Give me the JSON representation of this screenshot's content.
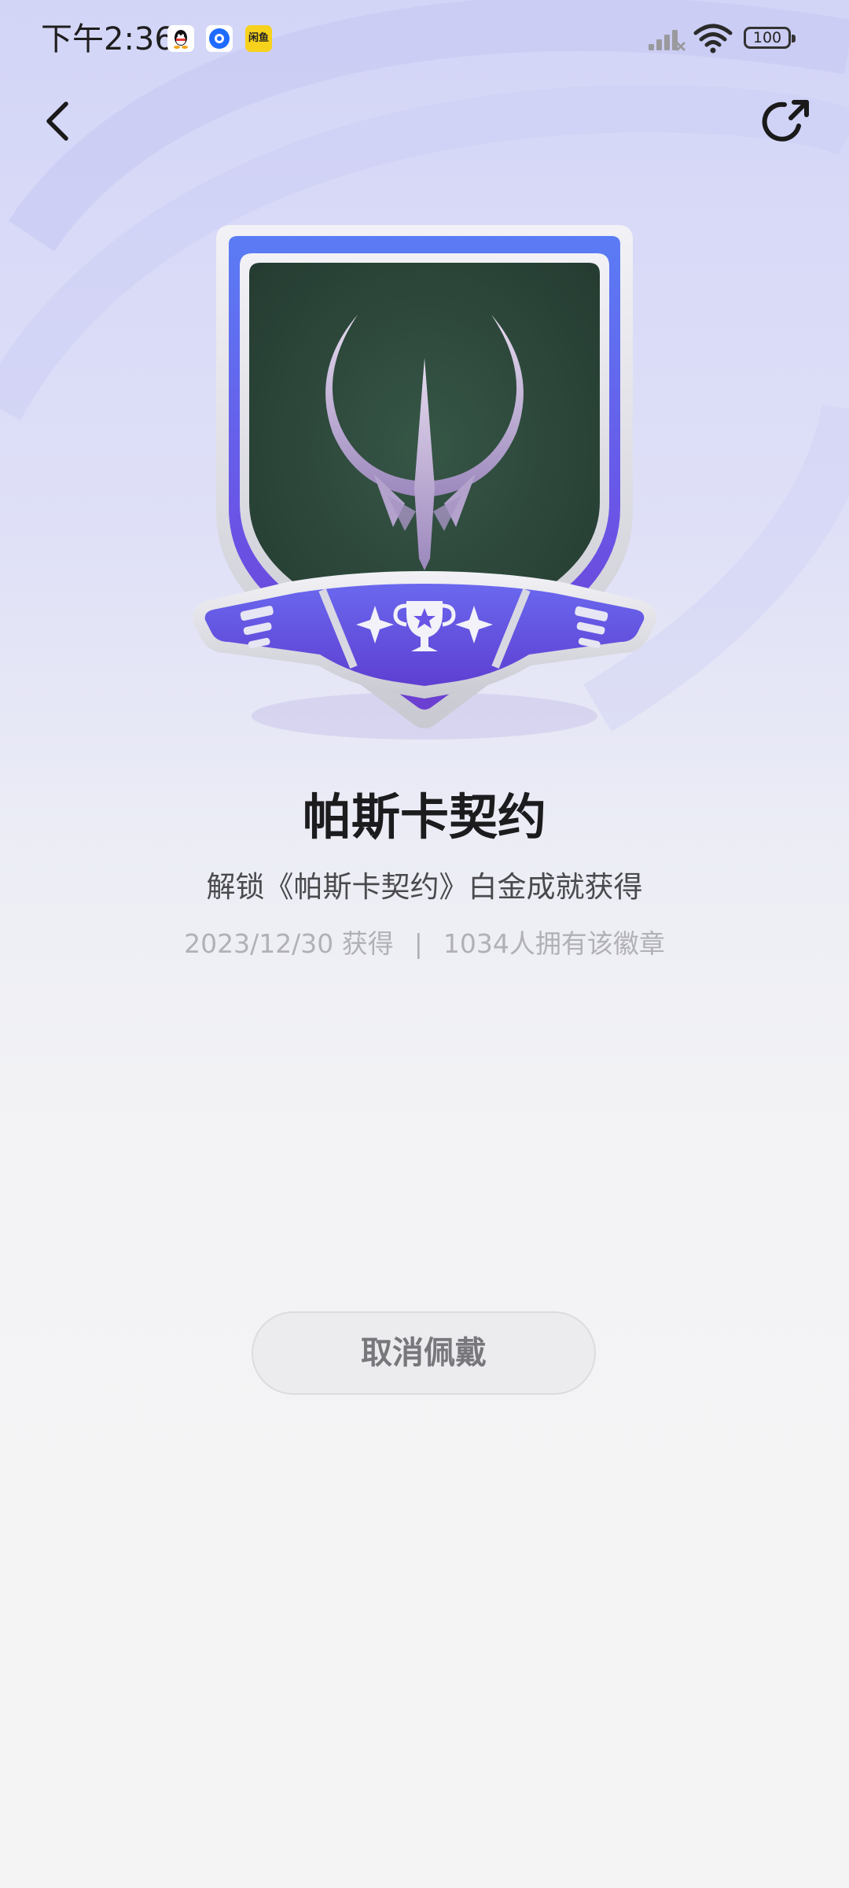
{
  "status_bar": {
    "time": "下午2:36",
    "battery": "100",
    "notification_icons": [
      "qq-icon",
      "blue-app-icon",
      "xianyu-icon"
    ],
    "xianyu_label": "闲鱼"
  },
  "nav": {
    "back_icon": "chevron-left-icon",
    "share_icon": "share-icon"
  },
  "badge": {
    "name": "帕斯卡契约",
    "description": "解锁《帕斯卡契约》白金成就获得",
    "obtained_date": "2023/12/30 获得",
    "separator": "|",
    "owners": "1034人拥有该徽章",
    "colors": {
      "frame": "#5b6cf0",
      "frame_bottom": "#6a44d8",
      "shield_inner": "#2d4a3c",
      "silver": "#d8d8de",
      "emblem": "#c9b8dc"
    }
  },
  "actions": {
    "cancel_wear": "取消佩戴"
  }
}
